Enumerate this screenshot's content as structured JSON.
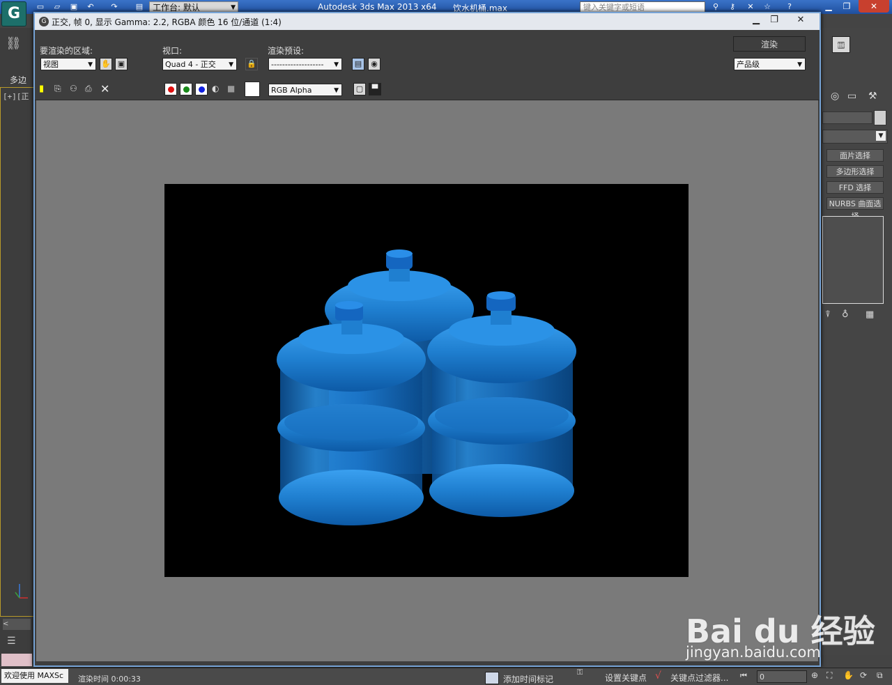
{
  "app": {
    "workspace_label": "工作台: 默认",
    "app_name": "Autodesk 3ds Max  2013 x64",
    "file_name": "饮水机桶.max",
    "search_placeholder": "键入关键字或短语",
    "left_panel_label": "多边",
    "viewport_label": "[+][正"
  },
  "render_window": {
    "title": "正交, 帧 0, 显示 Gamma: 2.2, RGBA 颜色 16 位/通道 (1:4)",
    "area_label": "要渲染的区域:",
    "area_value": "视图",
    "viewport_label": "视口:",
    "viewport_value": "Quad 4 - 正交",
    "preset_label": "渲染预设:",
    "preset_value": "-------------------",
    "render_button": "渲染",
    "quality_value": "产品级",
    "channel_value": "RGB Alpha",
    "channel_colors": {
      "red": "#e01010",
      "green": "#1a8a1a",
      "blue": "#1020e0"
    }
  },
  "command_panel": {
    "buttons": [
      "面片选择",
      "多边形选择",
      "FFD 选择",
      "NURBS 曲面选择"
    ]
  },
  "status": {
    "welcome": "欢迎使用 MAXSc",
    "render_time": "渲染时间 0:00:33",
    "add_time_tag": "添加时间标记",
    "set_key": "设置关键点",
    "key_filter": "关键点过滤器...",
    "frame_value": "0"
  },
  "watermark": {
    "brand": "Bai du 经验",
    "url": "jingyan.baidu.com"
  },
  "colors": {
    "bottle_blue": "#1f7fd0",
    "title_bar": "#2f63b4"
  }
}
